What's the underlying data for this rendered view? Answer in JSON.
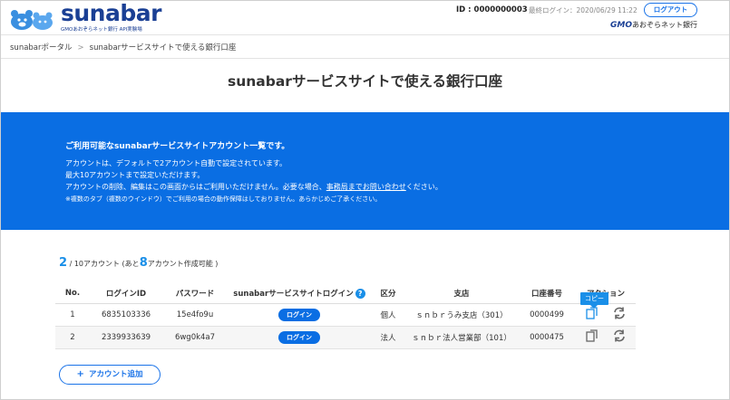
{
  "header": {
    "logo_text": "sunabar",
    "logo_sub_bank": "GMOあおぞらネット銀行",
    "logo_sub_sandbox": "API実験場",
    "user_id": "ID : 0000000003",
    "last_login": "最終ログイン：2020/06/29 11:22",
    "logout_label": "ログアウト",
    "bank_logo_gmo": "GMO",
    "bank_logo_text": "あおぞらネット銀行"
  },
  "breadcrumb": {
    "home": "sunabarポータル",
    "separator": ">",
    "current": "sunabarサービスサイトで使える銀行口座"
  },
  "page_title": "sunabarサービスサイトで使える銀行口座",
  "band": {
    "title": "ご利用可能なsunabarサービスサイトアカウント一覧です。",
    "line1": "アカウントは、デフォルトで2アカウント自動で設定されています。",
    "line2": "最大10アカウントまで設定いただけます。",
    "line3_before": "アカウントの削除、編集はこの画面からはご利用いただけません。必要な場合、",
    "line3_link": "事務局までお問い合わせ",
    "line3_after": "ください。",
    "line4": "※複数のタブ（複数のウインドウ）でご利用の場合の動作保障はしておりません。あらかじめご了承ください。"
  },
  "count": {
    "current": "2",
    "max_text": "/ 10アカウント (あと",
    "remaining": "8",
    "suffix": "アカウント作成可能 )"
  },
  "table": {
    "headers": {
      "no": "No.",
      "login_id": "ログインID",
      "password": "パスワード",
      "site_login": "sunabarサービスサイトログイン",
      "type": "区分",
      "branch": "支店",
      "account_no": "口座番号",
      "action": "アクション"
    },
    "help_glyph": "?",
    "login_button": "ログイン",
    "rows": [
      {
        "no": "1",
        "login_id": "6835103336",
        "password": "15e4fo9u",
        "type": "個人",
        "branch": "ｓｎｂｒうみ支店（301）",
        "account_no": "0000499"
      },
      {
        "no": "2",
        "login_id": "2339933639",
        "password": "6wg0k4a7",
        "type": "法人",
        "branch": "ｓｎｂｒ法人営業部（101）",
        "account_no": "0000475"
      }
    ]
  },
  "tooltip": "コピー",
  "add_button": {
    "icon": "+",
    "label": "アカウント追加"
  },
  "colors": {
    "brand_blue": "#0a6ee3",
    "logo_navy": "#1a3f94",
    "accent": "#1a8fe8"
  },
  "icons": [
    "bear-mascot-icon",
    "copy-icon",
    "refresh-icon",
    "help-icon",
    "plus-icon"
  ]
}
